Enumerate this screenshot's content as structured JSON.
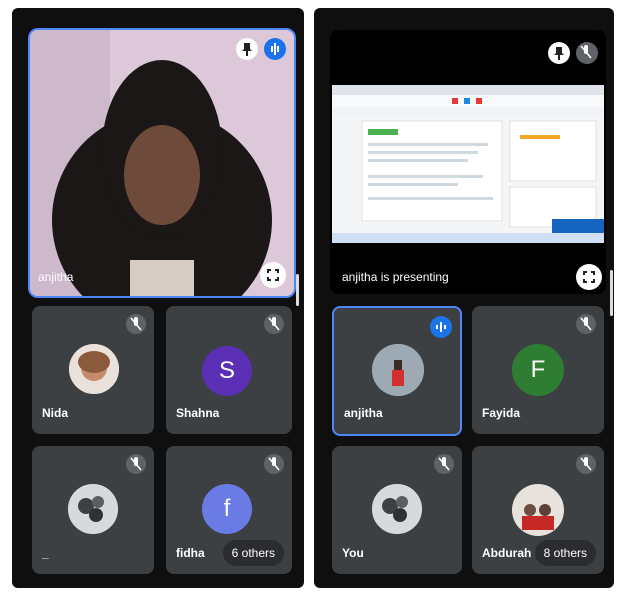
{
  "left": {
    "main_speaker": "anjitha",
    "participants": [
      {
        "name": "Nida",
        "type": "photo"
      },
      {
        "name": "Shahna",
        "type": "letter",
        "letter": "S",
        "color": "#5b2fb5"
      },
      {
        "name": "_",
        "type": "photo"
      },
      {
        "name": "fidha",
        "type": "letter",
        "letter": "f",
        "color": "#6a7be6"
      }
    ],
    "others_count": "6 others"
  },
  "right": {
    "presenting_label": "anjitha is presenting",
    "participants": [
      {
        "name": "anjitha",
        "type": "photo"
      },
      {
        "name": "Fayida",
        "type": "letter",
        "letter": "F",
        "color": "#2e7d32"
      },
      {
        "name": "You",
        "type": "photo"
      },
      {
        "name": "Abdurah",
        "type": "photo"
      }
    ],
    "others_count": "8 others"
  },
  "icons": {
    "pin": "pin-icon",
    "mic_off": "mic-off-icon",
    "speaking": "speaking-indicator-icon",
    "fullscreen": "fullscreen-icon"
  },
  "colors": {
    "accent": "#4f86f7",
    "tile_bg": "#3c4043",
    "panel_bg": "#0f0f10"
  }
}
